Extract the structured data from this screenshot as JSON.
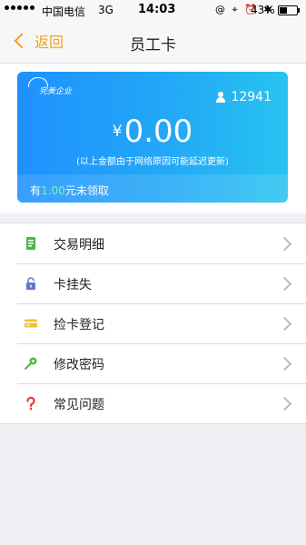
{
  "status_bar": {
    "carrier": "中国电信",
    "network": "3G",
    "time": "14:03",
    "status_icons": "@ ⌖ ⏰ ✱",
    "battery": "43%"
  },
  "nav": {
    "back_label": "返回",
    "title": "员工卡"
  },
  "card": {
    "logo_text": "完美企业",
    "user_id": "12941",
    "currency_symbol": "¥",
    "amount": "0.00",
    "note": "(以上金额由于网络原因可能延迟更新)",
    "unclaimed_prefix": "有",
    "unclaimed_value": "1.00",
    "unclaimed_suffix": "元未领取"
  },
  "menu": {
    "items": [
      {
        "label": "交易明细",
        "icon": "ledger-icon",
        "color": "#4cb548"
      },
      {
        "label": "卡挂失",
        "icon": "lock-icon",
        "color": "#6675c9"
      },
      {
        "label": "捡卡登记",
        "icon": "card-icon",
        "color": "#f1c232"
      },
      {
        "label": "修改密码",
        "icon": "key-icon",
        "color": "#58b947"
      },
      {
        "label": "常见问题",
        "icon": "question-icon",
        "color": "#e53935"
      }
    ]
  },
  "colors": {
    "accent": "#f0a21c",
    "card_gradient_start": "#1e91ff",
    "card_gradient_end": "#28c3f0",
    "unclaimed_value": "#7ff2b8"
  }
}
